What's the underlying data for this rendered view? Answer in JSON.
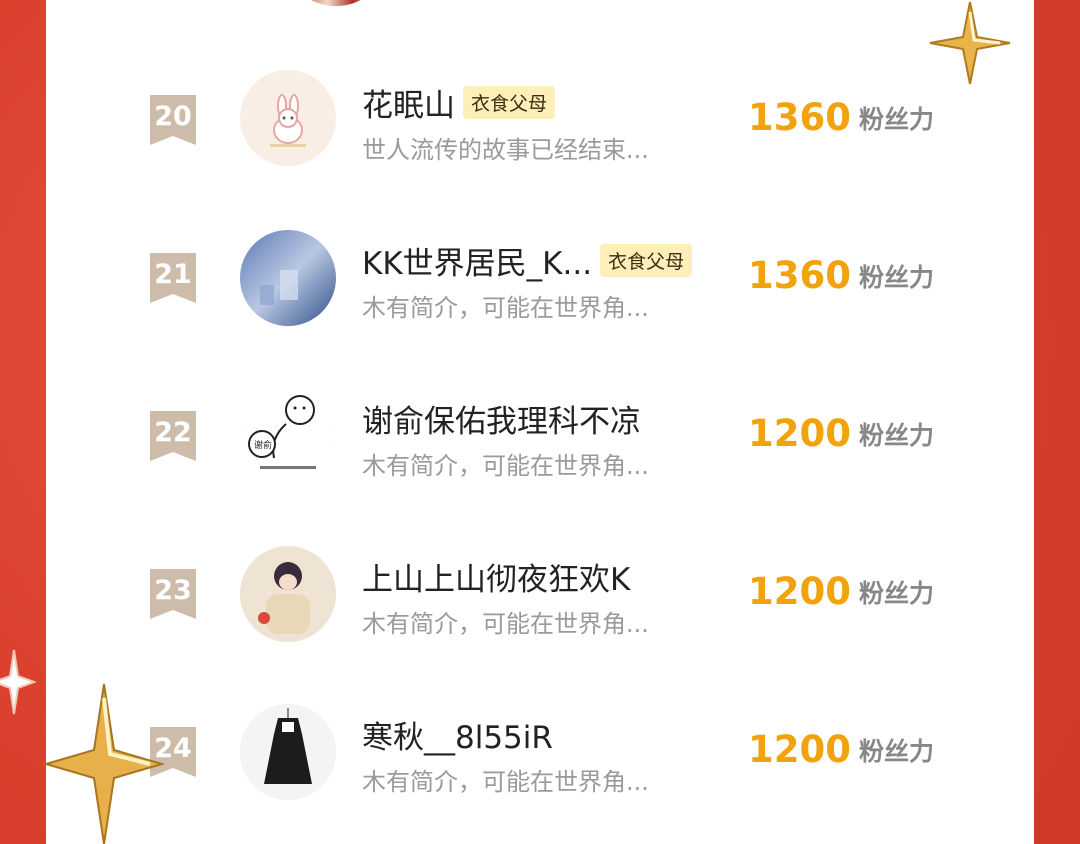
{
  "rows": [
    {
      "rank": "20",
      "name": "花眠山",
      "badge": "衣食父母",
      "desc": "世人流传的故事已经结束...",
      "score": "1360",
      "unit": "粉丝力",
      "avatar": "bunny-avatar"
    },
    {
      "rank": "21",
      "name": "KK世界居民_K...",
      "badge": "衣食父母",
      "desc": "木有简介，可能在世界角...",
      "score": "1360",
      "unit": "粉丝力",
      "avatar": "city-avatar"
    },
    {
      "rank": "22",
      "name": "谢俞保佑我理科不凉",
      "badge": "",
      "desc": "木有简介，可能在世界角...",
      "score": "1200",
      "unit": "粉丝力",
      "avatar": "doodle-avatar"
    },
    {
      "rank": "23",
      "name": "上山上山彻夜狂欢K",
      "badge": "",
      "desc": "木有简介，可能在世界角...",
      "score": "1200",
      "unit": "粉丝力",
      "avatar": "anime-avatar"
    },
    {
      "rank": "24",
      "name": "寒秋__8l55iR",
      "badge": "",
      "desc": "木有简介，可能在世界角...",
      "score": "1200",
      "unit": "粉丝力",
      "avatar": "dress-avatar"
    }
  ],
  "colors": {
    "background": "#d9402d",
    "score": "#f2a20b",
    "rank": "#cdbcaa",
    "badge_bg": "#fdefb8"
  }
}
